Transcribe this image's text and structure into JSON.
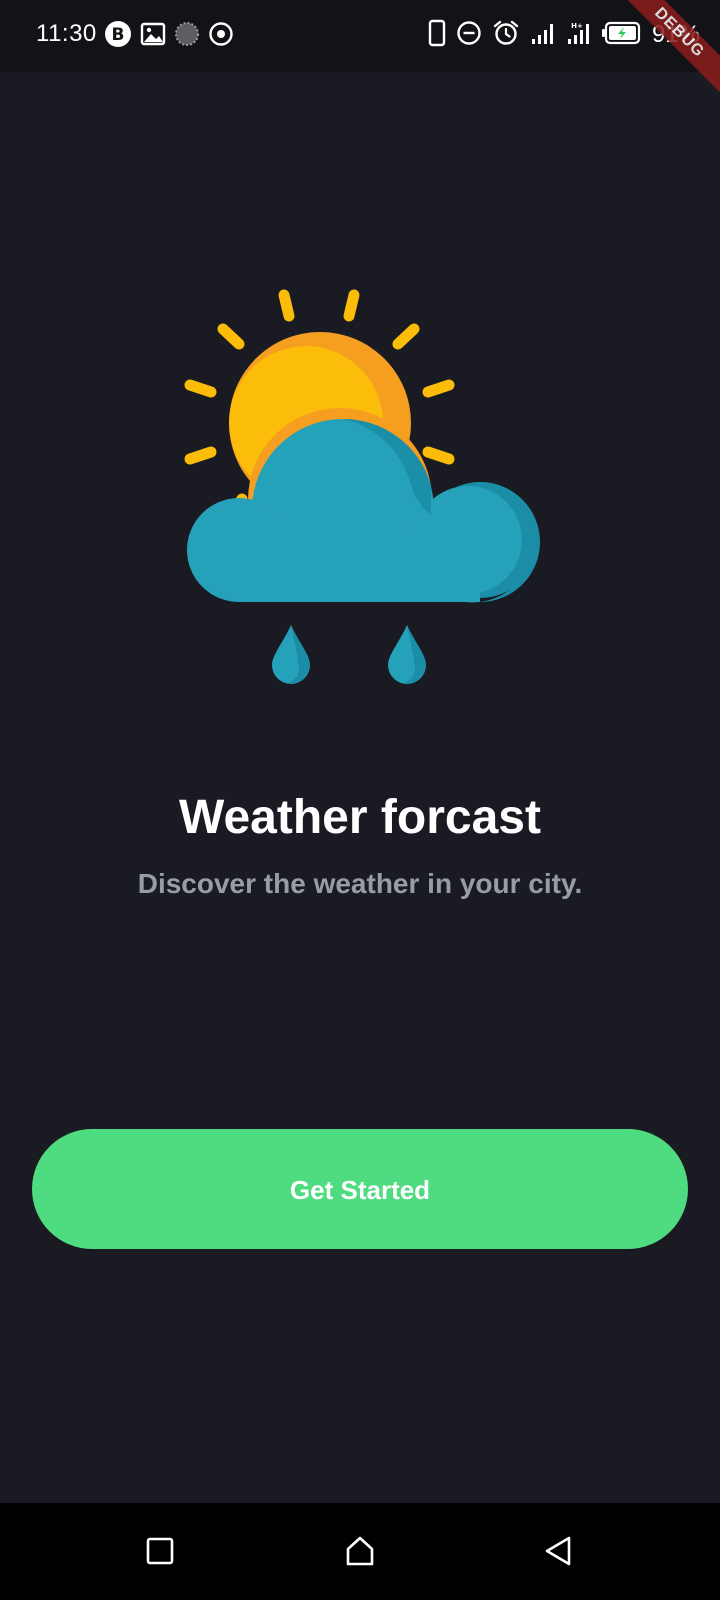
{
  "status_bar": {
    "time": "11:30",
    "battery_percent": "91%",
    "debug_label": "DEBUG",
    "left_icons": [
      "bitcoin-icon",
      "gallery-icon",
      "loading-icon",
      "record-icon"
    ],
    "right_icons": [
      "phone-icon",
      "do-not-disturb-icon",
      "alarm-icon",
      "signal-icon",
      "signal-icon",
      "battery-charging-icon"
    ]
  },
  "onboarding": {
    "title": "Weather forcast",
    "subtitle": "Discover the weather in your city.",
    "button_label": "Get Started",
    "illustration": "sun-cloud-rain-icon"
  },
  "nav_bar": {
    "buttons": [
      "recents-icon",
      "home-icon",
      "back-icon"
    ]
  },
  "colors": {
    "background": "#1a1b22",
    "status_bar": "#121317",
    "accent_button": "#4fdb80",
    "title": "#ffffff",
    "subtitle": "#9a9ca3",
    "sun": "#fbbc0a",
    "sun_shadow": "#f59e20",
    "cloud": "#26a1ba",
    "cloud_shadow": "#1c8da6"
  }
}
